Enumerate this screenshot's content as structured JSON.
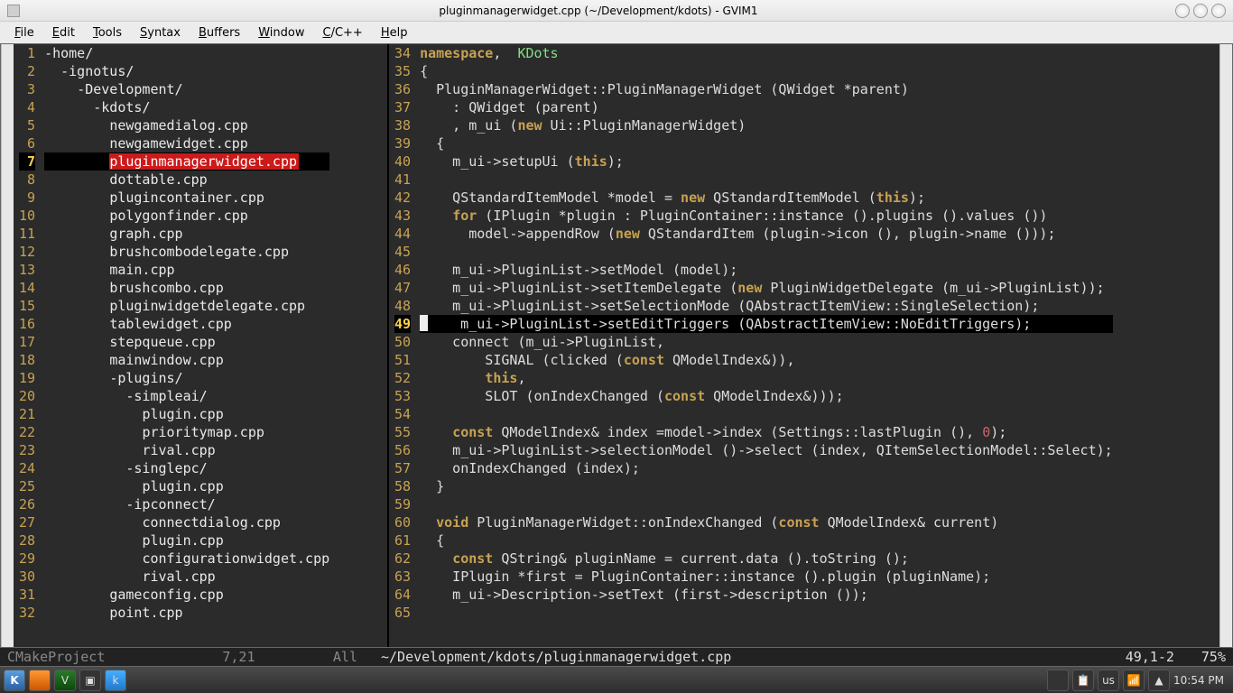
{
  "title": "pluginmanagerwidget.cpp (~/Development/kdots) - GVIM1",
  "menubar": [
    "File",
    "Edit",
    "Tools",
    "Syntax",
    "Buffers",
    "Window",
    "C/C++",
    "Help"
  ],
  "tree": {
    "current_line": 7,
    "lines": [
      {
        "n": 1,
        "indent": 0,
        "text": "-home/",
        "dir": true
      },
      {
        "n": 2,
        "indent": 1,
        "text": "-ignotus/",
        "dir": true
      },
      {
        "n": 3,
        "indent": 2,
        "text": "-Development/",
        "dir": true
      },
      {
        "n": 4,
        "indent": 3,
        "text": "-kdots/",
        "dir": true
      },
      {
        "n": 5,
        "indent": 4,
        "text": "newgamedialog.cpp"
      },
      {
        "n": 6,
        "indent": 4,
        "text": "newgamewidget.cpp"
      },
      {
        "n": 7,
        "indent": 4,
        "text": "pluginmanagerwidget.cpp",
        "selected": true
      },
      {
        "n": 8,
        "indent": 4,
        "text": "dottable.cpp"
      },
      {
        "n": 9,
        "indent": 4,
        "text": "plugincontainer.cpp"
      },
      {
        "n": 10,
        "indent": 4,
        "text": "polygonfinder.cpp"
      },
      {
        "n": 11,
        "indent": 4,
        "text": "graph.cpp"
      },
      {
        "n": 12,
        "indent": 4,
        "text": "brushcombodelegate.cpp"
      },
      {
        "n": 13,
        "indent": 4,
        "text": "main.cpp"
      },
      {
        "n": 14,
        "indent": 4,
        "text": "brushcombo.cpp"
      },
      {
        "n": 15,
        "indent": 4,
        "text": "pluginwidgetdelegate.cpp"
      },
      {
        "n": 16,
        "indent": 4,
        "text": "tablewidget.cpp"
      },
      {
        "n": 17,
        "indent": 4,
        "text": "stepqueue.cpp"
      },
      {
        "n": 18,
        "indent": 4,
        "text": "mainwindow.cpp"
      },
      {
        "n": 19,
        "indent": 4,
        "text": "-plugins/",
        "dir": true
      },
      {
        "n": 20,
        "indent": 5,
        "text": "-simpleai/",
        "dir": true
      },
      {
        "n": 21,
        "indent": 6,
        "text": "plugin.cpp"
      },
      {
        "n": 22,
        "indent": 6,
        "text": "prioritymap.cpp"
      },
      {
        "n": 23,
        "indent": 6,
        "text": "rival.cpp"
      },
      {
        "n": 24,
        "indent": 5,
        "text": "-singlepc/",
        "dir": true
      },
      {
        "n": 25,
        "indent": 6,
        "text": "plugin.cpp"
      },
      {
        "n": 26,
        "indent": 5,
        "text": "-ipconnect/",
        "dir": true
      },
      {
        "n": 27,
        "indent": 6,
        "text": "connectdialog.cpp"
      },
      {
        "n": 28,
        "indent": 6,
        "text": "plugin.cpp"
      },
      {
        "n": 29,
        "indent": 6,
        "text": "configurationwidget.cpp"
      },
      {
        "n": 30,
        "indent": 6,
        "text": "rival.cpp"
      },
      {
        "n": 31,
        "indent": 4,
        "text": "gameconfig.cpp"
      },
      {
        "n": 32,
        "indent": 4,
        "text": "point.cpp"
      }
    ]
  },
  "code": {
    "current_line": 49,
    "first_line": 34,
    "lines": [
      {
        "n": 34,
        "t": [
          [
            "kw",
            "namespace"
          ],
          [
            "",
            ", "
          ],
          [
            "",
            " "
          ],
          [
            "type",
            "KDots"
          ]
        ]
      },
      {
        "n": 35,
        "raw": "{"
      },
      {
        "n": 36,
        "raw": "  PluginManagerWidget::PluginManagerWidget (QWidget *parent)"
      },
      {
        "n": 37,
        "t": [
          [
            "",
            "    : QWidget (parent)"
          ]
        ]
      },
      {
        "n": 38,
        "t": [
          [
            "",
            "    , m_ui ("
          ],
          [
            "kw",
            "new"
          ],
          [
            "",
            " Ui::PluginManagerWidget)"
          ]
        ]
      },
      {
        "n": 39,
        "raw": "  {"
      },
      {
        "n": 40,
        "t": [
          [
            "",
            "    m_ui->setupUi ("
          ],
          [
            "kw",
            "this"
          ],
          [
            "",
            ");"
          ]
        ]
      },
      {
        "n": 41,
        "raw": ""
      },
      {
        "n": 42,
        "t": [
          [
            "",
            "    QStandardItemModel *model = "
          ],
          [
            "kw",
            "new"
          ],
          [
            "",
            " QStandardItemModel ("
          ],
          [
            "kw",
            "this"
          ],
          [
            "",
            ");"
          ]
        ]
      },
      {
        "n": 43,
        "t": [
          [
            "",
            "    "
          ],
          [
            "kw",
            "for"
          ],
          [
            "",
            " (IPlugin *plugin : PluginContainer::instance ().plugins ().values ())"
          ]
        ]
      },
      {
        "n": 44,
        "t": [
          [
            "",
            "      model->appendRow ("
          ],
          [
            "kw",
            "new"
          ],
          [
            "",
            " QStandardItem (plugin->icon (), plugin->name ()));"
          ]
        ]
      },
      {
        "n": 45,
        "raw": ""
      },
      {
        "n": 46,
        "raw": "    m_ui->PluginList->setModel (model);"
      },
      {
        "n": 47,
        "t": [
          [
            "",
            "    m_ui->PluginList->setItemDelegate ("
          ],
          [
            "kw",
            "new"
          ],
          [
            "",
            " PluginWidgetDelegate (m_ui->PluginList));"
          ]
        ]
      },
      {
        "n": 48,
        "raw": "    m_ui->PluginList->setSelectionMode (QAbstractItemView::SingleSelection);"
      },
      {
        "n": 49,
        "raw": "    m_ui->PluginList->setEditTriggers (QAbstractItemView::NoEditTriggers);",
        "cursor": true
      },
      {
        "n": 50,
        "raw": "    connect (m_ui->PluginList,"
      },
      {
        "n": 51,
        "t": [
          [
            "",
            "        SIGNAL (clicked ("
          ],
          [
            "kw",
            "const"
          ],
          [
            "",
            " QModelIndex&)),"
          ]
        ]
      },
      {
        "n": 52,
        "t": [
          [
            "",
            "        "
          ],
          [
            "kw",
            "this"
          ],
          [
            "",
            ","
          ]
        ]
      },
      {
        "n": 53,
        "t": [
          [
            "",
            "        SLOT (onIndexChanged ("
          ],
          [
            "kw",
            "const"
          ],
          [
            "",
            " QModelIndex&)));"
          ]
        ]
      },
      {
        "n": 54,
        "raw": ""
      },
      {
        "n": 55,
        "t": [
          [
            "",
            "    "
          ],
          [
            "kw",
            "const"
          ],
          [
            "",
            " QModelIndex& index =model->index (Settings::lastPlugin (), "
          ],
          [
            "num",
            "0"
          ],
          [
            "",
            ");"
          ]
        ]
      },
      {
        "n": 56,
        "raw": "    m_ui->PluginList->selectionModel ()->select (index, QItemSelectionModel::Select);"
      },
      {
        "n": 57,
        "raw": "    onIndexChanged (index);"
      },
      {
        "n": 58,
        "raw": "  }"
      },
      {
        "n": 59,
        "raw": ""
      },
      {
        "n": 60,
        "t": [
          [
            "",
            "  "
          ],
          [
            "kw",
            "void"
          ],
          [
            "",
            " PluginManagerWidget::onIndexChanged ("
          ],
          [
            "kw",
            "const"
          ],
          [
            "",
            " QModelIndex& current)"
          ]
        ]
      },
      {
        "n": 61,
        "raw": "  {"
      },
      {
        "n": 62,
        "t": [
          [
            "",
            "    "
          ],
          [
            "kw",
            "const"
          ],
          [
            "",
            " QString& pluginName = current.data ().toString ();"
          ]
        ]
      },
      {
        "n": 63,
        "raw": "    IPlugin *first = PluginContainer::instance ().plugin (pluginName);"
      },
      {
        "n": 64,
        "raw": "    m_ui->Description->setText (first->description ());"
      },
      {
        "n": 65,
        "raw": ""
      }
    ]
  },
  "status": {
    "left_mode": "CMakeProject",
    "left_ruler": "7,21",
    "left_all": "All",
    "right_path": "~/Development/kdots/pluginmanagerwidget.cpp",
    "right_pos": "49,1-2",
    "right_pct": "75%"
  },
  "taskbar": {
    "layout": "us",
    "clock": "10:54 PM"
  }
}
